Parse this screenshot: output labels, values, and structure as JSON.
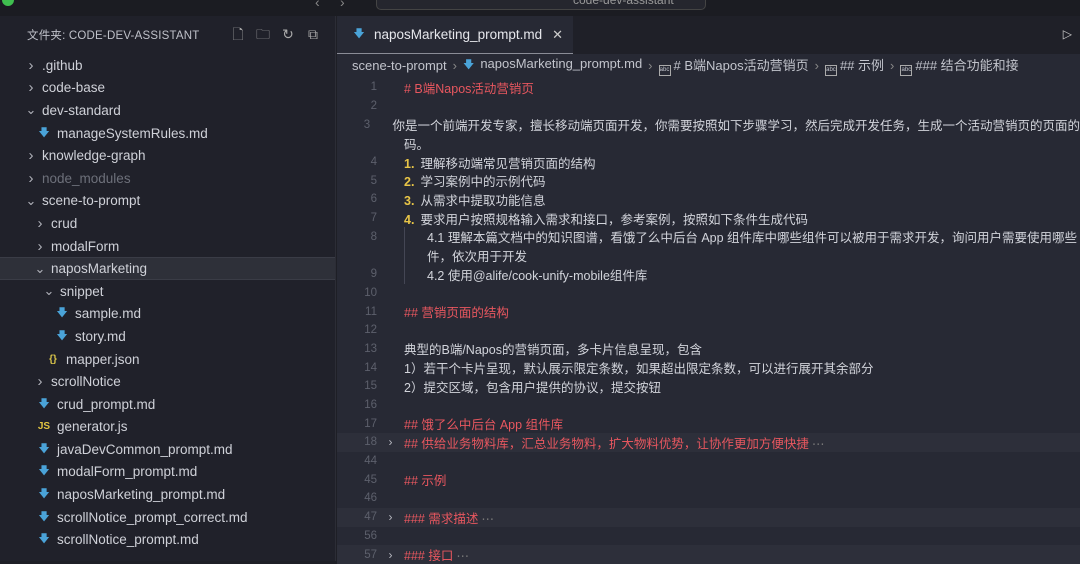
{
  "sidebar": {
    "title": "文件夹: CODE-DEV-ASSISTANT",
    "items": [
      {
        "label": ".github",
        "type": "folder",
        "open": false,
        "indent": 0
      },
      {
        "label": "code-base",
        "type": "folder",
        "open": false,
        "indent": 0
      },
      {
        "label": "dev-standard",
        "type": "folder",
        "open": true,
        "indent": 0
      },
      {
        "label": "manageSystemRules.md",
        "type": "md",
        "indent": 1
      },
      {
        "label": "knowledge-graph",
        "type": "folder",
        "open": false,
        "indent": 0
      },
      {
        "label": "node_modules",
        "type": "folder",
        "open": false,
        "indent": 0,
        "dim": true
      },
      {
        "label": "scene-to-prompt",
        "type": "folder",
        "open": true,
        "indent": 0
      },
      {
        "label": "crud",
        "type": "folder",
        "open": false,
        "indent": 1
      },
      {
        "label": "modalForm",
        "type": "folder",
        "open": false,
        "indent": 1
      },
      {
        "label": "naposMarketing",
        "type": "folder",
        "open": true,
        "indent": 1,
        "selected": true
      },
      {
        "label": "snippet",
        "type": "folder",
        "open": true,
        "indent": 2
      },
      {
        "label": "sample.md",
        "type": "md",
        "indent": 3
      },
      {
        "label": "story.md",
        "type": "md",
        "indent": 3
      },
      {
        "label": "mapper.json",
        "type": "json",
        "indent": 2
      },
      {
        "label": "scrollNotice",
        "type": "folder",
        "open": false,
        "indent": 1
      },
      {
        "label": "crud_prompt.md",
        "type": "md",
        "indent": 1
      },
      {
        "label": "generator.js",
        "type": "js",
        "indent": 1
      },
      {
        "label": "javaDevCommon_prompt.md",
        "type": "md",
        "indent": 1
      },
      {
        "label": "modalForm_prompt.md",
        "type": "md",
        "indent": 1
      },
      {
        "label": "naposMarketing_prompt.md",
        "type": "md",
        "indent": 1
      },
      {
        "label": "scrollNotice_prompt_correct.md",
        "type": "md",
        "indent": 1
      },
      {
        "label": "scrollNotice_prompt.md",
        "type": "md",
        "indent": 1
      }
    ]
  },
  "topbar": {
    "search": "code-dev-assistant"
  },
  "tab": {
    "label": "naposMarketing_prompt.md"
  },
  "breadcrumb": [
    "scene-to-prompt",
    "naposMarketing_prompt.md",
    "# B端Napos活动营销页",
    "## 示例",
    "### 结合功能和接"
  ],
  "lines": [
    {
      "n": "1",
      "t": "# B端Napos活动营销页",
      "h": true
    },
    {
      "n": "2",
      "t": ""
    },
    {
      "n": "3",
      "t": "你是一个前端开发专家，擅长移动端页面开发，你需要按照如下步骤学习，然后完成开发任务，生成一个活动营销页的页面的"
    },
    {
      "n": "",
      "t": "码。"
    },
    {
      "n": "4",
      "m": "1.",
      "t": "理解移动端常见营销页面的结构"
    },
    {
      "n": "5",
      "m": "2.",
      "t": "学习案例中的示例代码"
    },
    {
      "n": "6",
      "m": "3.",
      "t": "从需求中提取功能信息"
    },
    {
      "n": "7",
      "m": "4.",
      "t": "要求用户按照规格输入需求和接口，参考案例，按照如下条件生成代码"
    },
    {
      "n": "8",
      "t": "4.1 理解本篇文档中的知识图谱，看饿了么中后台 App 组件库中哪些组件可以被用于需求开发，询问用户需要使用哪些",
      "ind": true
    },
    {
      "n": "",
      "t": "件，依次用于开发",
      "ind": true
    },
    {
      "n": "9",
      "t": "4.2 使用@alife/cook-unify-mobile组件库",
      "ind": true
    },
    {
      "n": "10",
      "t": ""
    },
    {
      "n": "11",
      "t": "## 营销页面的结构",
      "h": true
    },
    {
      "n": "12",
      "t": ""
    },
    {
      "n": "13",
      "t": "典型的B端/Napos的营销页面，多卡片信息呈现，包含"
    },
    {
      "n": "14",
      "t": "1）若干个卡片呈现，默认展示限定条数，如果超出限定条数，可以进行展开其余部分"
    },
    {
      "n": "15",
      "t": "2）提交区域，包含用户提供的协议，提交按钮"
    },
    {
      "n": "16",
      "t": ""
    },
    {
      "n": "17",
      "t": "## 饿了么中后台 App 组件库",
      "h": true
    },
    {
      "n": "18",
      "t": "## 供给业务物料库，汇总业务物料，扩大物料优势，让协作更加方便快捷",
      "h": true,
      "fold": true
    },
    {
      "n": "44",
      "t": ""
    },
    {
      "n": "45",
      "t": "## 示例",
      "h": true
    },
    {
      "n": "46",
      "t": ""
    },
    {
      "n": "47",
      "t": "### 需求描述",
      "h": true,
      "fold": true
    },
    {
      "n": "56",
      "t": ""
    },
    {
      "n": "57",
      "t": "### 接口",
      "h": true,
      "fold": true
    }
  ]
}
